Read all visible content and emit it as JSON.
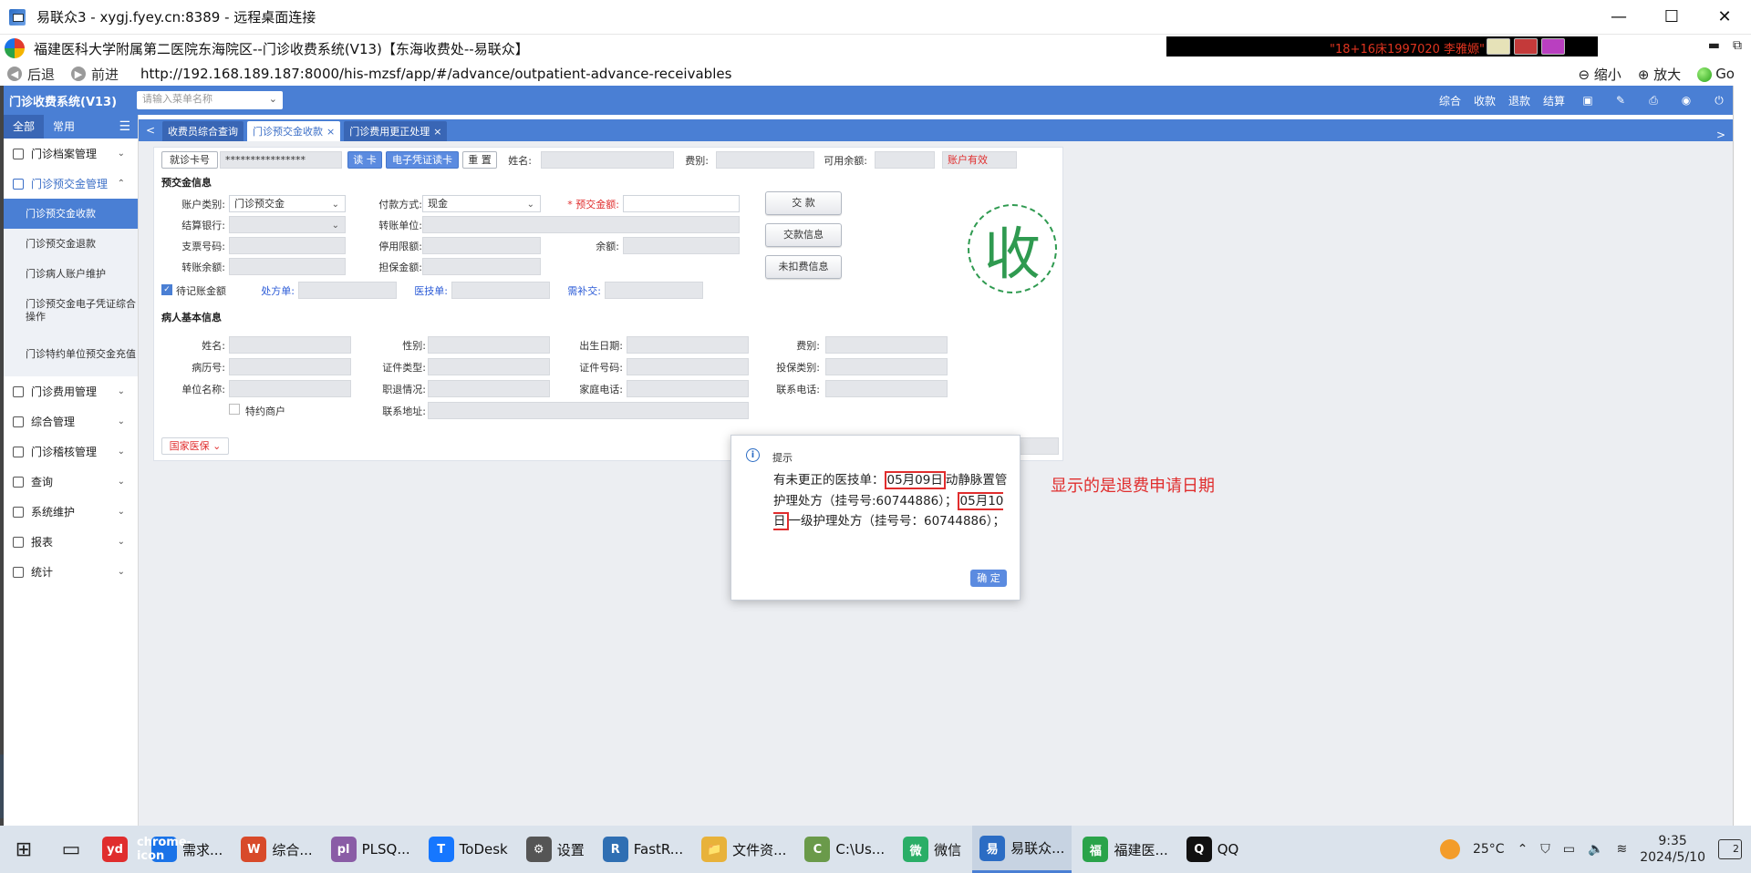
{
  "rdp": {
    "title": "易联众3 - xygj.fyey.cn:8389 - 远程桌面连接",
    "minimize": "—",
    "maximize": "☐",
    "close": "✕"
  },
  "browser": {
    "page_title": "福建医科大学附属第二医院东海院区--门诊收费系统(V13)【东海收费处--易联众】",
    "user_banner": "\"18+16床1997020 李雅嫄\"",
    "back_label": "后退",
    "forward_label": "前进",
    "url": "http://192.168.189.187:8000/his-mzsf/app/#/advance/outpatient-advance-receivables",
    "zoom_out_label": "缩小",
    "zoom_in_label": "放大",
    "go_label": "Go"
  },
  "app": {
    "system_name": "门诊收费系统(V13)",
    "menu_search_placeholder": "请输入菜单名称",
    "header_links": [
      "综合",
      "收款",
      "退款",
      "结算"
    ]
  },
  "sidebar": {
    "tab_all": "全部",
    "tab_common": "常用",
    "items": [
      {
        "label": "门诊档案管理"
      },
      {
        "label": "门诊预交金管理"
      },
      {
        "label": "门诊费用管理"
      },
      {
        "label": "综合管理"
      },
      {
        "label": "门诊稽核管理"
      },
      {
        "label": "查询"
      },
      {
        "label": "系统维护"
      },
      {
        "label": "报表"
      },
      {
        "label": "统计"
      }
    ],
    "subitems": [
      {
        "label": "门诊预交金收款"
      },
      {
        "label": "门诊预交金退款"
      },
      {
        "label": "门诊病人账户维护"
      },
      {
        "label": "门诊预交金电子凭证综合操作"
      },
      {
        "label": "门诊特约单位预交金充值"
      }
    ]
  },
  "tabs": [
    {
      "label": "收费员综合查询"
    },
    {
      "label": "门诊预交金收款"
    },
    {
      "label": "门诊费用更正处理"
    }
  ],
  "form": {
    "card_label": "就诊卡号",
    "card_value": "****************",
    "read_card": "读 卡",
    "e_voucher": "电子凭证读卡",
    "reset": "重 置",
    "name_label": "姓名:",
    "fee_type_label": "费别:",
    "balance_label": "可用余额:",
    "account_status": "账户有效",
    "section_advance": "预交金信息",
    "account_type_label": "账户类别:",
    "account_type_value": "门诊预交金",
    "pay_method_label": "付款方式:",
    "pay_method_value": "现金",
    "advance_amount_label": "预交金额:",
    "settle_bank_label": "结算银行:",
    "transfer_unit_label": "转账单位:",
    "check_no_label": "支票号码:",
    "stop_limit_label": "停用限额:",
    "remain_label": "余额:",
    "transfer_remain_label": "转账余额:",
    "guarantee_label": "担保金额:",
    "pending_label": "待记账金额",
    "prescription_label": "处方单:",
    "tech_label": "医技单:",
    "need_pay_label": "需补交:",
    "pay_button": "交 款",
    "pay_info_button": "交款信息",
    "undeducted_button": "未扣费信息",
    "stamp": "收",
    "section_patient": "病人基本信息",
    "p_name": "姓名:",
    "p_gender": "性别:",
    "p_birth": "出生日期:",
    "p_fee": "费别:",
    "p_record": "病历号:",
    "p_id_type": "证件类型:",
    "p_id_no": "证件号码:",
    "p_insure": "投保类别:",
    "p_unit": "单位名称:",
    "p_job": "职退情况:",
    "p_home_phone": "家庭电话:",
    "p_contact_phone": "联系电话:",
    "p_vip": "特约商户",
    "p_address": "联系地址:",
    "national_insurance": "国家医保"
  },
  "dialog": {
    "title": "提示",
    "msg_part1": "有未更正的医技单：",
    "date1": "05月09日",
    "msg_part2": "动静脉置管护理处方（挂号号:60744886）；",
    "date2": "05月10日",
    "msg_part3": "一级护理处方（挂号号：60744886）；",
    "ok": "确 定"
  },
  "note": "显示的是退费申请日期",
  "taskbar": {
    "tasks": [
      {
        "label": "",
        "icon": "yd",
        "color": "#e02d2d"
      },
      {
        "label": "需求...",
        "icon": "chrome-icon",
        "color": "#1a73e8"
      },
      {
        "label": "综合...",
        "icon": "W",
        "color": "#d84a2a"
      },
      {
        "label": "PLSQ...",
        "icon": "pl",
        "color": "#8a5ca6"
      },
      {
        "label": "ToDesk",
        "icon": "T",
        "color": "#1677ff"
      },
      {
        "label": "设置",
        "icon": "⚙",
        "color": "#555"
      },
      {
        "label": "FastR...",
        "icon": "R",
        "color": "#2f6fb3"
      },
      {
        "label": "文件资...",
        "icon": "📁",
        "color": "#e8b23a"
      },
      {
        "label": "C:\\Us...",
        "icon": "C",
        "color": "#6a9a4a"
      },
      {
        "label": "微信",
        "icon": "微",
        "color": "#2aae67"
      },
      {
        "label": "易联众...",
        "icon": "易",
        "color": "#2b6cc4"
      },
      {
        "label": "福建医...",
        "icon": "福",
        "color": "#2aa34a"
      },
      {
        "label": "QQ",
        "icon": "Q",
        "color": "#111"
      }
    ],
    "temperature": "25°C",
    "time": "9:35",
    "date": "2024/5/10",
    "notifications": "2"
  }
}
